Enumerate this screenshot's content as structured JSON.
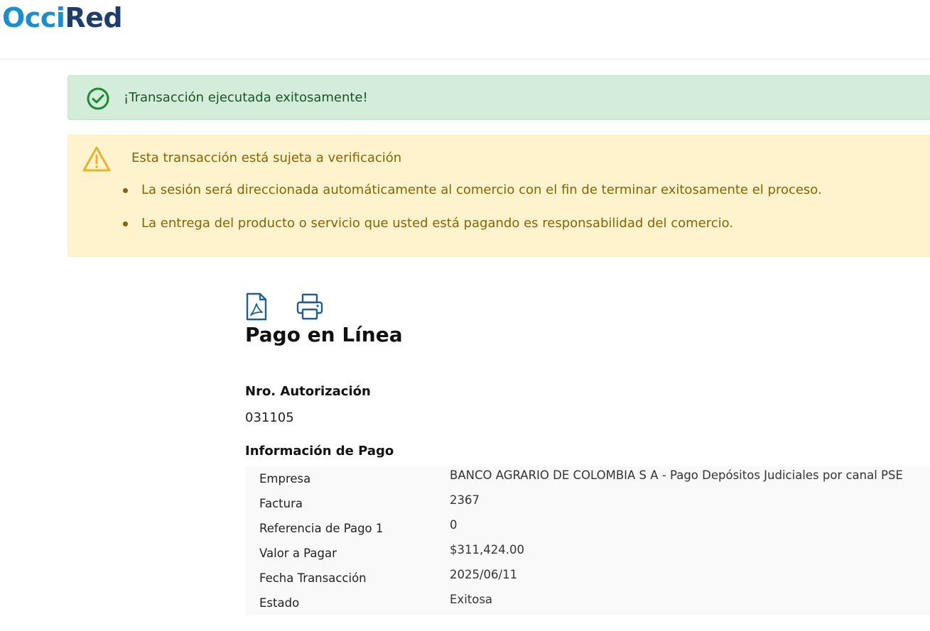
{
  "header": {
    "logo_part1": "Occi",
    "logo_part2": "Red"
  },
  "alerts": {
    "success_text": "¡Transacción ejecutada exitosamente!",
    "warning_title": "Esta transacción está sujeta a verificación",
    "warning_items": [
      "La sesión será direccionada automáticamente al comercio con el fin de terminar exitosamente el proceso.",
      "La entrega del producto o servicio que usted está pagando es responsabilidad del comercio."
    ]
  },
  "toolbar": {
    "pdf_icon": "file-pdf-icon",
    "print_icon": "printer-icon"
  },
  "main": {
    "title": "Pago en Línea",
    "auth_label": "Nro. Autorización",
    "auth_value": "031105",
    "payment_info_label": "Información de Pago",
    "rows": [
      {
        "key": "Empresa",
        "value": "BANCO AGRARIO DE COLOMBIA S A - Pago Depósitos Judiciales por canal PSE"
      },
      {
        "key": "Factura",
        "value": "2367"
      },
      {
        "key": "Referencia de Pago 1",
        "value": "0"
      },
      {
        "key": "Valor a Pagar",
        "value": "$311,424.00"
      },
      {
        "key": "Fecha Transacción",
        "value": "2025/06/11"
      },
      {
        "key": "Estado",
        "value": "Exitosa"
      }
    ]
  },
  "colors": {
    "brand_light": "#1a8fce",
    "brand_dark": "#1c3d6e",
    "success_bg": "#d4edda",
    "warning_bg": "#fff3cd",
    "icon_blue": "#1e5f8c"
  }
}
